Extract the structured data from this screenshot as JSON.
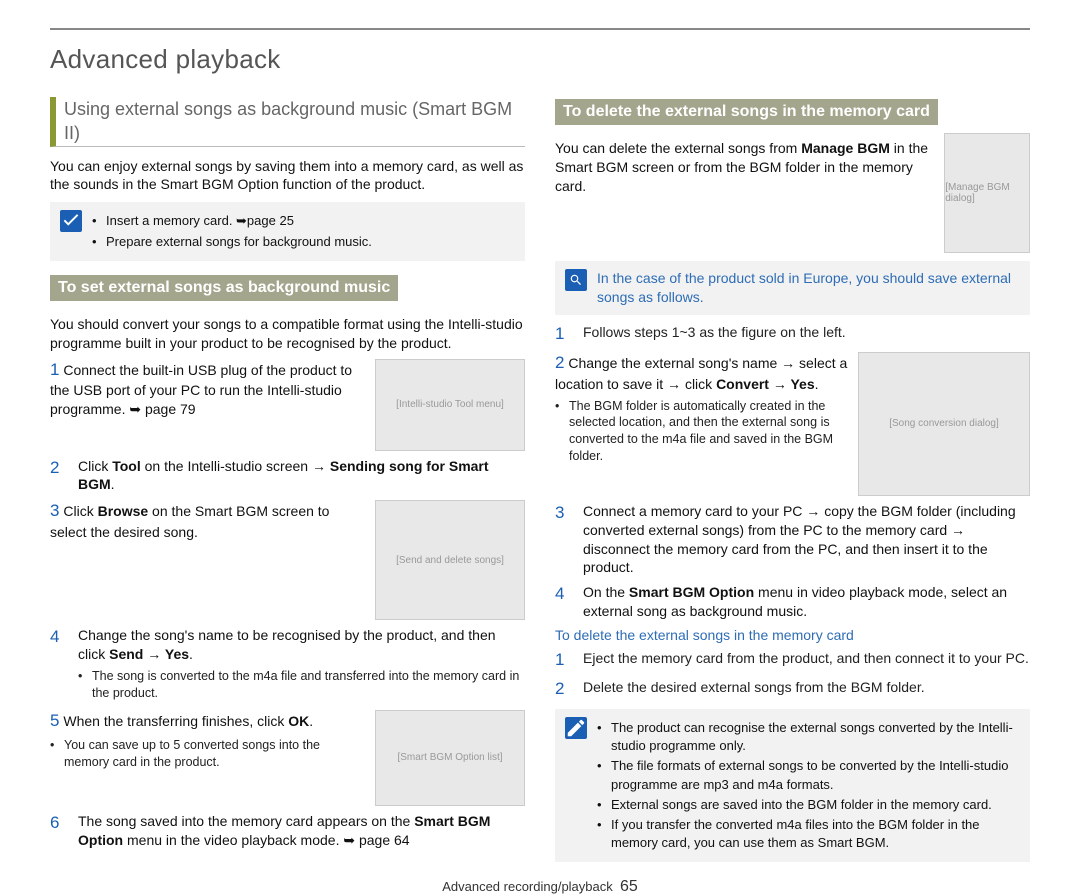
{
  "title": "Advanced playback",
  "section_subhead": "Using external songs as background music (Smart BGM II)",
  "intro": "You can enjoy external songs by saving them into a memory card, as well as the sounds in the Smart BGM Option function of the product.",
  "prep": {
    "items": [
      "Insert a memory card. ➥page 25",
      "Prepare external songs for background music."
    ]
  },
  "set_heading": "To set external songs as background music",
  "set_intro": "You should convert your songs to a compatible format using the Intelli-studio programme built in your product to be recognised by the product.",
  "steps": [
    {
      "n": "1",
      "text": "Connect the built-in USB plug of the product to the USB port of your PC to run the Intelli-studio programme. ➥ page 79"
    },
    {
      "n": "2",
      "text_pre": "Click ",
      "bold1": "Tool",
      "text_mid": " on the Intelli-studio screen → ",
      "bold2": "Sending song for Smart BGM",
      "text_post": "."
    },
    {
      "n": "3",
      "text_pre": "Click ",
      "bold1": "Browse",
      "text_post": " on the Smart BGM screen to select the desired song."
    },
    {
      "n": "4",
      "text_pre": "Change the song's name to be recognised by the product, and then click ",
      "bold1": "Send → Yes",
      "text_post": ".",
      "sub": [
        "The song is converted to the m4a file and transferred into the memory card in the product."
      ]
    },
    {
      "n": "5",
      "text_pre": "When the transferring finishes, click ",
      "bold1": "OK",
      "text_post": ".",
      "sub": [
        "You can save up to 5 converted songs into the memory card in the product."
      ]
    },
    {
      "n": "6",
      "text_pre": "The song saved into the memory card appears on the ",
      "bold1": "Smart BGM Option",
      "text_mid": " menu in the video playback mode. ➥ page 64"
    }
  ],
  "del_heading": "To delete the external songs in the memory card",
  "del_intro_pre": "You can delete the external songs from ",
  "del_intro_bold": "Manage BGM",
  "del_intro_post": " in the Smart BGM screen or from the BGM folder in the memory card.",
  "europe_note": "In the case of the product sold in Europe, you should save external songs as follows.",
  "eu_steps": [
    {
      "n": "1",
      "text": "Follows steps 1~3 as the figure on the left."
    },
    {
      "n": "2",
      "text_pre": "Change the external song's name → select a location to save it → click ",
      "bold1": "Convert → Yes",
      "text_post": ".",
      "sub": [
        "The BGM folder is automatically created in the selected location, and then the external song is converted to the m4a file and saved in the BGM folder."
      ]
    },
    {
      "n": "3",
      "text": "Connect a memory card to your PC → copy the BGM folder (including converted external songs) from the PC to the memory card → disconnect the memory card from the PC, and then insert it to the product."
    },
    {
      "n": "4",
      "text_pre": "On the ",
      "bold1": "Smart BGM Option",
      "text_post": " menu in video playback mode, select an external song as background music."
    }
  ],
  "del2_heading": "To delete the external songs in the memory card",
  "del2_steps": [
    {
      "n": "1",
      "text": "Eject the memory card from the product, and then connect it to your PC."
    },
    {
      "n": "2",
      "text": "Delete the desired external songs from the BGM folder."
    }
  ],
  "notes": [
    "The product can recognise the external songs converted by the Intelli-studio programme only.",
    "The file formats of external songs to be converted by the Intelli-studio programme are mp3 and m4a formats.",
    "External songs are saved into the BGM folder in the memory card.",
    "If you transfer the converted m4a files into the BGM folder in the memory card, you can use them as Smart BGM."
  ],
  "footer_label": "Advanced recording/playback",
  "footer_page": "65",
  "thumbs": {
    "a": "[Intelli-studio Tool menu]",
    "b": "[Send and delete songs]",
    "c": "[Smart BGM Option list]",
    "d": "[Manage BGM dialog]",
    "e": "[Song conversion dialog]"
  }
}
